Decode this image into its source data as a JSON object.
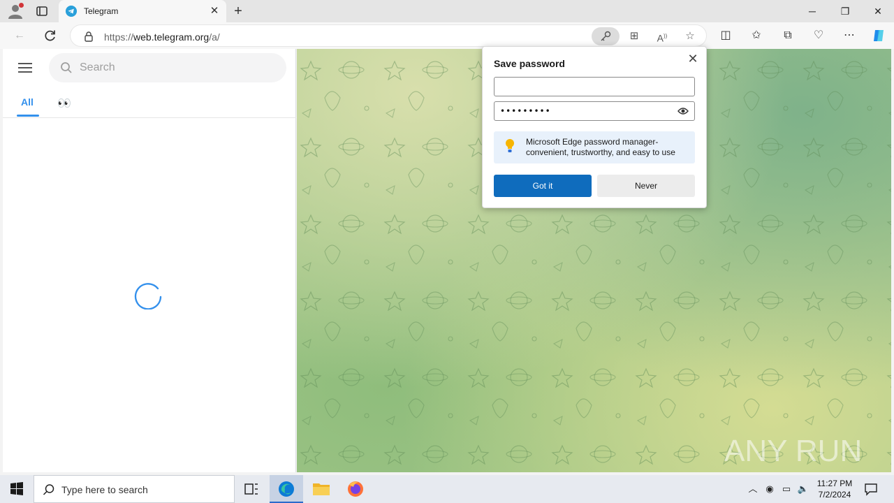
{
  "browser": {
    "tab_title": "Telegram",
    "tab_close_icon": "close-icon",
    "new_tab_icon": "plus-icon",
    "url_prefix": "https://",
    "url_host": "web.telegram.org",
    "url_path": "/a/",
    "window_controls": {
      "minimize": "─",
      "restore": "❐",
      "close": "✕"
    }
  },
  "telegram": {
    "search_placeholder": "Search",
    "filter_tabs": [
      "All",
      "👀"
    ],
    "active_tab": "All",
    "accent_color": "#3390ec"
  },
  "save_password_popup": {
    "title": "Save password",
    "username_value": "",
    "password_value": "•••••••••",
    "info_text": "Microsoft Edge password manager- convenient, trustworthy, and easy to use",
    "primary_button": "Got it",
    "secondary_button": "Never"
  },
  "watermark": {
    "text": "ANY RUN"
  },
  "taskbar": {
    "search_placeholder": "Type here to search",
    "time": "11:27 PM",
    "date": "7/2/2024"
  }
}
